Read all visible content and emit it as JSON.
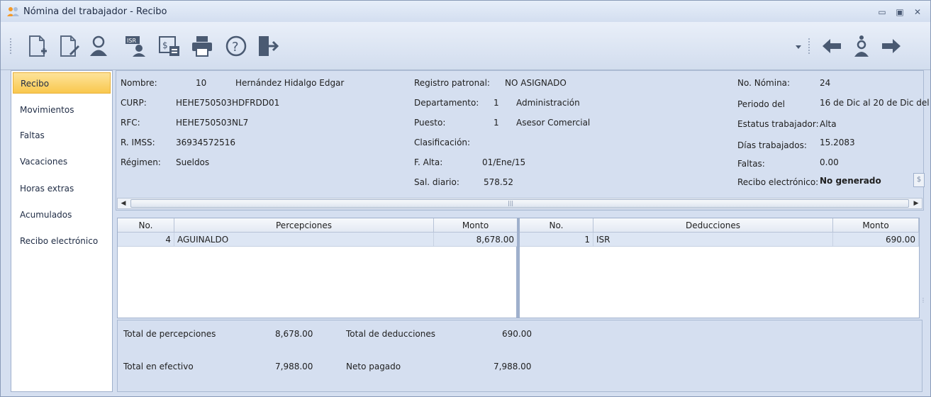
{
  "window": {
    "title": "Nómina del trabajador - Recibo",
    "controls": [
      "▭",
      "▣",
      "✕"
    ]
  },
  "sidebar": {
    "items": [
      {
        "label": "Recibo",
        "active": true
      },
      {
        "label": "Movimientos"
      },
      {
        "label": "Faltas"
      },
      {
        "label": "Vacaciones"
      },
      {
        "label": "Horas extras"
      },
      {
        "label": "Acumulados"
      },
      {
        "label": "Recibo electrónico"
      }
    ]
  },
  "employee": {
    "nombre_label": "Nombre:",
    "nombre_num": "10",
    "nombre_value": "Hernández Hidalgo Edgar",
    "curp_label": "CURP:",
    "curp_value": "HEHE750503HDFRDD01",
    "rfc_label": "RFC:",
    "rfc_value": "HEHE750503NL7",
    "imss_label": "R. IMSS:",
    "imss_value": "36934572516",
    "regimen_label": "Régimen:",
    "regimen_value": "Sueldos",
    "registro_label": "Registro patronal:",
    "registro_value": "NO ASIGNADO",
    "depto_label": "Departamento:",
    "depto_num": "1",
    "depto_value": "Administración",
    "puesto_label": "Puesto:",
    "puesto_num": "1",
    "puesto_value": "Asesor Comercial",
    "clasif_label": "Clasificación:",
    "alta_label": "F. Alta:",
    "alta_value": "01/Ene/15",
    "sal_label": "Sal. diario:",
    "sal_value": "578.52",
    "nomina_label": "No. Nómina:",
    "nomina_value": "24",
    "periodo_label": "Periodo del",
    "periodo_value": "16 de Dic al 20 de Dic del",
    "estatus_label": "Estatus trabajador:",
    "estatus_value": "Alta",
    "dias_label": "Días trabajados:",
    "dias_value": "15.2083",
    "faltas_label": "Faltas:",
    "faltas_value": "0.00",
    "recibo_label": "Recibo electrónico:",
    "recibo_value": "No generado"
  },
  "percepciones": {
    "headers": [
      "No.",
      "Percepciones",
      "Monto"
    ],
    "rows": [
      {
        "no": "4",
        "concepto": "AGUINALDO",
        "monto": "8,678.00"
      }
    ]
  },
  "deducciones": {
    "headers": [
      "No.",
      "Deducciones",
      "Monto"
    ],
    "rows": [
      {
        "no": "1",
        "concepto": "ISR",
        "monto": "690.00"
      }
    ]
  },
  "totals": {
    "perc_label": "Total de percepciones",
    "perc_value": "8,678.00",
    "ded_label": "Total de deducciones",
    "ded_value": "690.00",
    "efectivo_label": "Total en efectivo",
    "efectivo_value": "7,988.00",
    "neto_label": "Neto pagado",
    "neto_value": "7,988.00"
  },
  "icons": {
    "toolbar": [
      "new-document-icon",
      "edit-document-icon",
      "user-icon",
      "isr-user-icon",
      "calculator-receipt-icon",
      "print-icon",
      "help-icon",
      "exit-icon"
    ],
    "nav": [
      "dropdown-icon",
      "previous-arrow-icon",
      "employee-icon",
      "next-arrow-icon"
    ]
  },
  "colors": {
    "accent": "#f9c84e",
    "window_bg": "#d5dff0",
    "row_bg": "#dde6f4"
  }
}
